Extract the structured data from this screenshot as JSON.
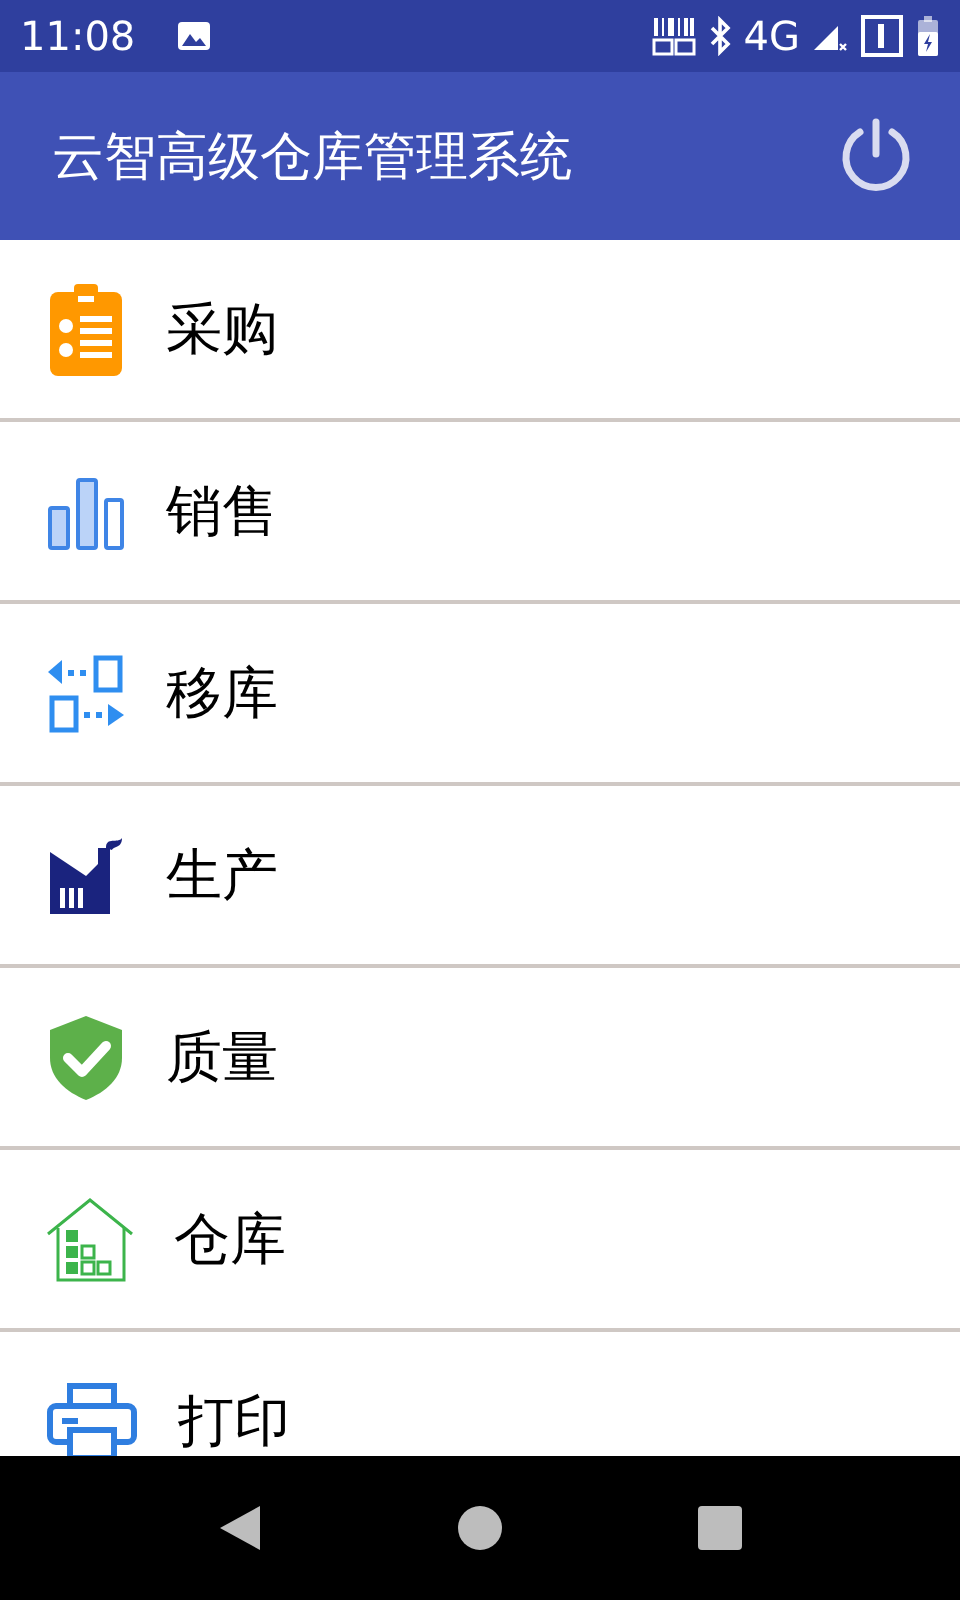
{
  "status_bar": {
    "time": "11:08",
    "network": "4G"
  },
  "app_bar": {
    "title": "云智高级仓库管理系统"
  },
  "menu": [
    {
      "label": "采购",
      "kind": "purchase"
    },
    {
      "label": "销售",
      "kind": "sales"
    },
    {
      "label": "移库",
      "kind": "transfer"
    },
    {
      "label": "生产",
      "kind": "production"
    },
    {
      "label": "质量",
      "kind": "quality"
    },
    {
      "label": "仓库",
      "kind": "warehouse"
    },
    {
      "label": "打印",
      "kind": "print"
    }
  ]
}
